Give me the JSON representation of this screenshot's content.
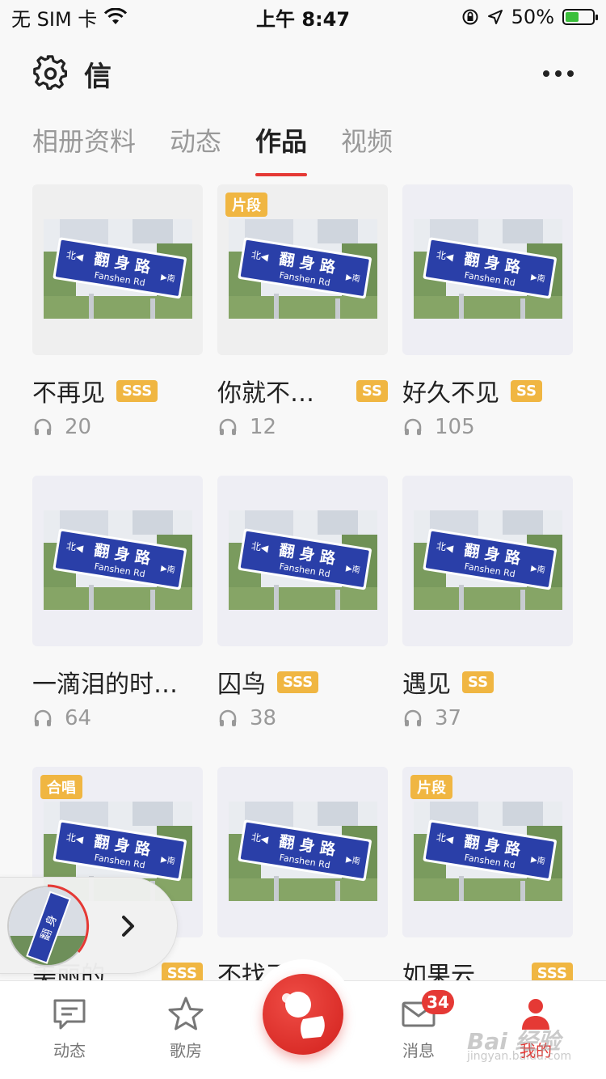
{
  "status_bar": {
    "carrier": "无 SIM 卡",
    "time": "上午 8:47",
    "battery_percent": "50%"
  },
  "header": {
    "title": "信"
  },
  "tabs": [
    {
      "label": "相册资料",
      "active": false
    },
    {
      "label": "动态",
      "active": false
    },
    {
      "label": "作品",
      "active": true
    },
    {
      "label": "视频",
      "active": false
    }
  ],
  "works": [
    {
      "title": "不再见",
      "badge": "SSS",
      "plays": "20",
      "tag": ""
    },
    {
      "title": "你就不…",
      "badge": "SS",
      "plays": "12",
      "tag": "片段"
    },
    {
      "title": "好久不见",
      "badge": "SS",
      "plays": "105",
      "tag": ""
    },
    {
      "title": "一滴泪的时…",
      "badge": "",
      "plays": "64",
      "tag": ""
    },
    {
      "title": "囚鸟",
      "badge": "SSS",
      "plays": "38",
      "tag": ""
    },
    {
      "title": "遇见",
      "badge": "SS",
      "plays": "37",
      "tag": ""
    },
    {
      "title": "美丽的…",
      "badge": "SSS",
      "plays": "",
      "tag": "合唱"
    },
    {
      "title": "不找了",
      "badge": "",
      "plays": "",
      "tag": ""
    },
    {
      "title": "如果云…",
      "badge": "SSS",
      "plays": "",
      "tag": "片段"
    }
  ],
  "sign": {
    "north": "北◀",
    "name": "翻 身 路",
    "english": "Fanshen Rd",
    "south": "▶南"
  },
  "tabbar": {
    "items": [
      {
        "label": "动态",
        "icon": "chat-icon"
      },
      {
        "label": "歌房",
        "icon": "star-icon"
      },
      {
        "label": "消息",
        "icon": "mail-icon",
        "badge": "34"
      },
      {
        "label": "我的",
        "icon": "user-icon"
      }
    ]
  },
  "watermark": {
    "main": "Bai 经验",
    "sub": "jingyan.baidu.com"
  },
  "colors": {
    "accent": "#e53935",
    "badge": "#f0b642",
    "sign_blue": "#2a3fa8"
  }
}
